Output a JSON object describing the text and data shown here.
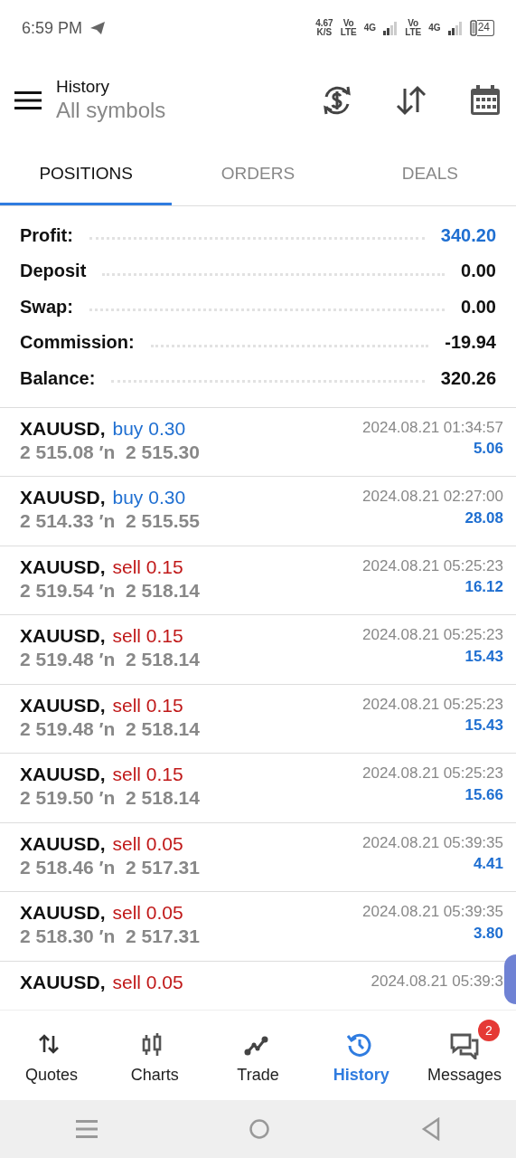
{
  "status_bar": {
    "time": "6:59 PM",
    "speed": "4.67",
    "speed_unit": "K/S",
    "sim1_volte": [
      "Vo",
      "LTE"
    ],
    "sim1_network": "4G",
    "sim2_volte": [
      "Vo",
      "LTE"
    ],
    "sim2_network": "4G",
    "battery": "24"
  },
  "header": {
    "title": "History",
    "subtitle": "All symbols"
  },
  "tabs": [
    {
      "label": "POSITIONS",
      "selected": true
    },
    {
      "label": "ORDERS",
      "selected": false
    },
    {
      "label": "DEALS",
      "selected": false
    }
  ],
  "summary": [
    {
      "label": "Profit:",
      "value": "340.20",
      "highlight": true
    },
    {
      "label": "Deposit",
      "value": "0.00",
      "highlight": false
    },
    {
      "label": "Swap:",
      "value": "0.00",
      "highlight": false
    },
    {
      "label": "Commission:",
      "value": "-19.94",
      "highlight": false
    },
    {
      "label": "Balance:",
      "value": "320.26",
      "highlight": false
    }
  ],
  "positions": [
    {
      "symbol": "XAUUSD,",
      "trade": "buy 0.30",
      "kind": "buy",
      "time": "2024.08.21 01:34:57",
      "prices": "2 515.08 ′n  2 515.30",
      "profit": "5.06"
    },
    {
      "symbol": "XAUUSD,",
      "trade": "buy 0.30",
      "kind": "buy",
      "time": "2024.08.21 02:27:00",
      "prices": "2 514.33 ′n  2 515.55",
      "profit": "28.08"
    },
    {
      "symbol": "XAUUSD,",
      "trade": "sell 0.15",
      "kind": "sell",
      "time": "2024.08.21 05:25:23",
      "prices": "2 519.54 ′n  2 518.14",
      "profit": "16.12"
    },
    {
      "symbol": "XAUUSD,",
      "trade": "sell 0.15",
      "kind": "sell",
      "time": "2024.08.21 05:25:23",
      "prices": "2 519.48 ′n  2 518.14",
      "profit": "15.43"
    },
    {
      "symbol": "XAUUSD,",
      "trade": "sell 0.15",
      "kind": "sell",
      "time": "2024.08.21 05:25:23",
      "prices": "2 519.48 ′n  2 518.14",
      "profit": "15.43"
    },
    {
      "symbol": "XAUUSD,",
      "trade": "sell 0.15",
      "kind": "sell",
      "time": "2024.08.21 05:25:23",
      "prices": "2 519.50 ′n  2 518.14",
      "profit": "15.66"
    },
    {
      "symbol": "XAUUSD,",
      "trade": "sell 0.05",
      "kind": "sell",
      "time": "2024.08.21 05:39:35",
      "prices": "2 518.46 ′n  2 517.31",
      "profit": "4.41"
    },
    {
      "symbol": "XAUUSD,",
      "trade": "sell 0.05",
      "kind": "sell",
      "time": "2024.08.21 05:39:35",
      "prices": "2 518.30 ′n  2 517.31",
      "profit": "3.80"
    },
    {
      "symbol": "XAUUSD,",
      "trade": "sell 0.05",
      "kind": "sell",
      "time": "2024.08.21 05:39:3"
    }
  ],
  "bottom_nav": [
    {
      "label": "Quotes",
      "selected": false
    },
    {
      "label": "Charts",
      "selected": false
    },
    {
      "label": "Trade",
      "selected": false
    },
    {
      "label": "History",
      "selected": true
    },
    {
      "label": "Messages",
      "selected": false,
      "badge": "2"
    }
  ]
}
